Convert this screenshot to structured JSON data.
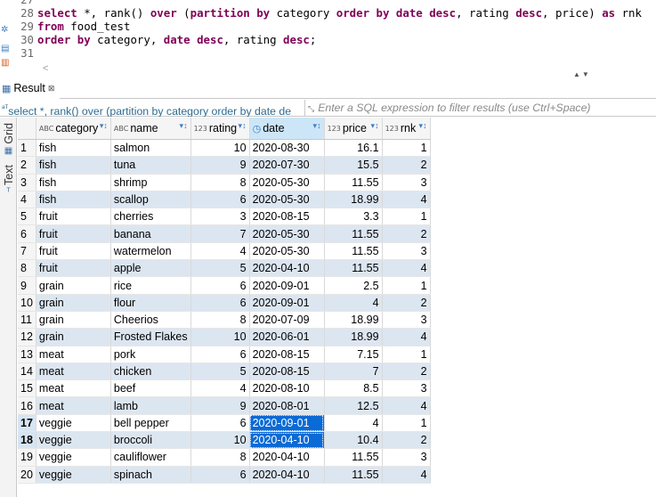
{
  "editor": {
    "lines": [
      {
        "num": "27",
        "parts": []
      },
      {
        "num": "28",
        "parts": [
          {
            "t": "select",
            "kw": true
          },
          {
            "t": " *, "
          },
          {
            "t": "rank",
            "kw": false
          },
          {
            "t": "() "
          },
          {
            "t": "over",
            "kw": true
          },
          {
            "t": " ("
          },
          {
            "t": "partition by",
            "kw": true
          },
          {
            "t": " category "
          },
          {
            "t": "order by",
            "kw": true
          },
          {
            "t": " "
          },
          {
            "t": "date",
            "kw": true
          },
          {
            "t": " "
          },
          {
            "t": "desc",
            "kw": true
          },
          {
            "t": ", rating "
          },
          {
            "t": "desc",
            "kw": true
          },
          {
            "t": ", price) "
          },
          {
            "t": "as",
            "kw": true
          },
          {
            "t": " rnk"
          }
        ]
      },
      {
        "num": "29",
        "parts": [
          {
            "t": "from",
            "kw": true
          },
          {
            "t": " food_test"
          }
        ]
      },
      {
        "num": "30",
        "parts": [
          {
            "t": "order by",
            "kw": true
          },
          {
            "t": " category, "
          },
          {
            "t": "date",
            "kw": true
          },
          {
            "t": " "
          },
          {
            "t": "desc",
            "kw": true
          },
          {
            "t": ", rating "
          },
          {
            "t": "desc",
            "kw": true
          },
          {
            "t": ";"
          }
        ]
      },
      {
        "num": "31",
        "parts": []
      }
    ]
  },
  "result_tab": {
    "label": "Result",
    "close": "⊠"
  },
  "filter": {
    "query_text": "select *, rank() over (partition by category order by date de",
    "placeholder": "Enter a SQL expression to filter results (use Ctrl+Space)"
  },
  "side_tabs": {
    "grid": "Grid",
    "text": "Text"
  },
  "grid": {
    "columns": [
      {
        "label": "category",
        "type": "ABC"
      },
      {
        "label": "name",
        "type": "ABC"
      },
      {
        "label": "rating",
        "type": "123"
      },
      {
        "label": "date",
        "type": "date"
      },
      {
        "label": "price",
        "type": "123"
      },
      {
        "label": "rnk",
        "type": "123"
      }
    ],
    "rows": [
      [
        "fish",
        "salmon",
        "10",
        "2020-08-30",
        "16.1",
        "1"
      ],
      [
        "fish",
        "tuna",
        "9",
        "2020-07-30",
        "15.5",
        "2"
      ],
      [
        "fish",
        "shrimp",
        "8",
        "2020-05-30",
        "11.55",
        "3"
      ],
      [
        "fish",
        "scallop",
        "6",
        "2020-05-30",
        "18.99",
        "4"
      ],
      [
        "fruit",
        "cherries",
        "3",
        "2020-08-15",
        "3.3",
        "1"
      ],
      [
        "fruit",
        "banana",
        "7",
        "2020-05-30",
        "11.55",
        "2"
      ],
      [
        "fruit",
        "watermelon",
        "4",
        "2020-05-30",
        "11.55",
        "3"
      ],
      [
        "fruit",
        "apple",
        "5",
        "2020-04-10",
        "11.55",
        "4"
      ],
      [
        "grain",
        "rice",
        "6",
        "2020-09-01",
        "2.5",
        "1"
      ],
      [
        "grain",
        "flour",
        "6",
        "2020-09-01",
        "4",
        "2"
      ],
      [
        "grain",
        "Cheerios",
        "8",
        "2020-07-09",
        "18.99",
        "3"
      ],
      [
        "grain",
        "Frosted Flakes",
        "10",
        "2020-06-01",
        "18.99",
        "4"
      ],
      [
        "meat",
        "pork",
        "6",
        "2020-08-15",
        "7.15",
        "1"
      ],
      [
        "meat",
        "chicken",
        "5",
        "2020-08-15",
        "7",
        "2"
      ],
      [
        "meat",
        "beef",
        "4",
        "2020-08-10",
        "8.5",
        "3"
      ],
      [
        "meat",
        "lamb",
        "9",
        "2020-08-01",
        "12.5",
        "4"
      ],
      [
        "veggie",
        "bell pepper",
        "6",
        "2020-09-01",
        "4",
        "1"
      ],
      [
        "veggie",
        "broccoli",
        "10",
        "2020-04-10",
        "10.4",
        "2"
      ],
      [
        "veggie",
        "cauliflower",
        "8",
        "2020-04-10",
        "11.55",
        "3"
      ],
      [
        "veggie",
        "spinach",
        "6",
        "2020-04-10",
        "11.55",
        "4"
      ]
    ],
    "selected_rows": [
      17,
      18
    ]
  }
}
